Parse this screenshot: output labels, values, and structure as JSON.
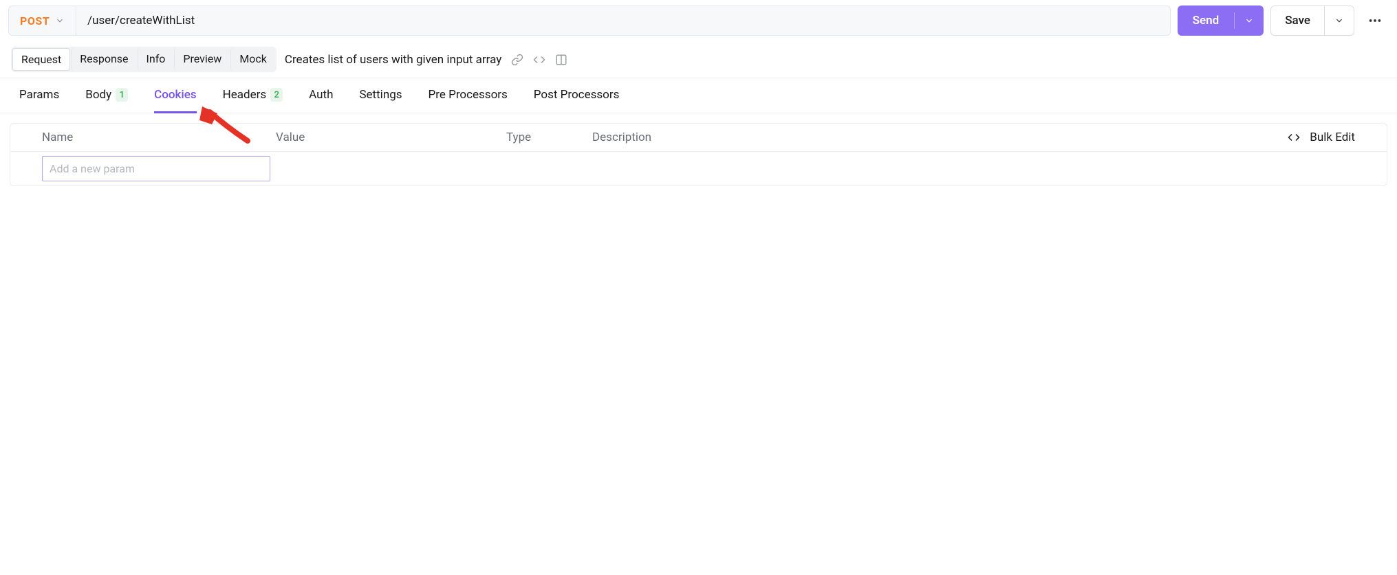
{
  "header": {
    "method": "POST",
    "url": "/user/createWithList",
    "send_label": "Send",
    "save_label": "Save"
  },
  "secondary": {
    "tabs": [
      "Request",
      "Response",
      "Info",
      "Preview",
      "Mock"
    ],
    "description": "Creates list of users with given input array"
  },
  "param_tabs": {
    "params": "Params",
    "body": {
      "label": "Body",
      "count": "1"
    },
    "cookies": "Cookies",
    "headers": {
      "label": "Headers",
      "count": "2"
    },
    "auth": "Auth",
    "settings": "Settings",
    "pre": "Pre Processors",
    "post": "Post Processors"
  },
  "table": {
    "columns": {
      "name": "Name",
      "value": "Value",
      "type": "Type",
      "description": "Description"
    },
    "bulk_edit": "Bulk Edit",
    "new_param_placeholder": "Add a new param"
  }
}
